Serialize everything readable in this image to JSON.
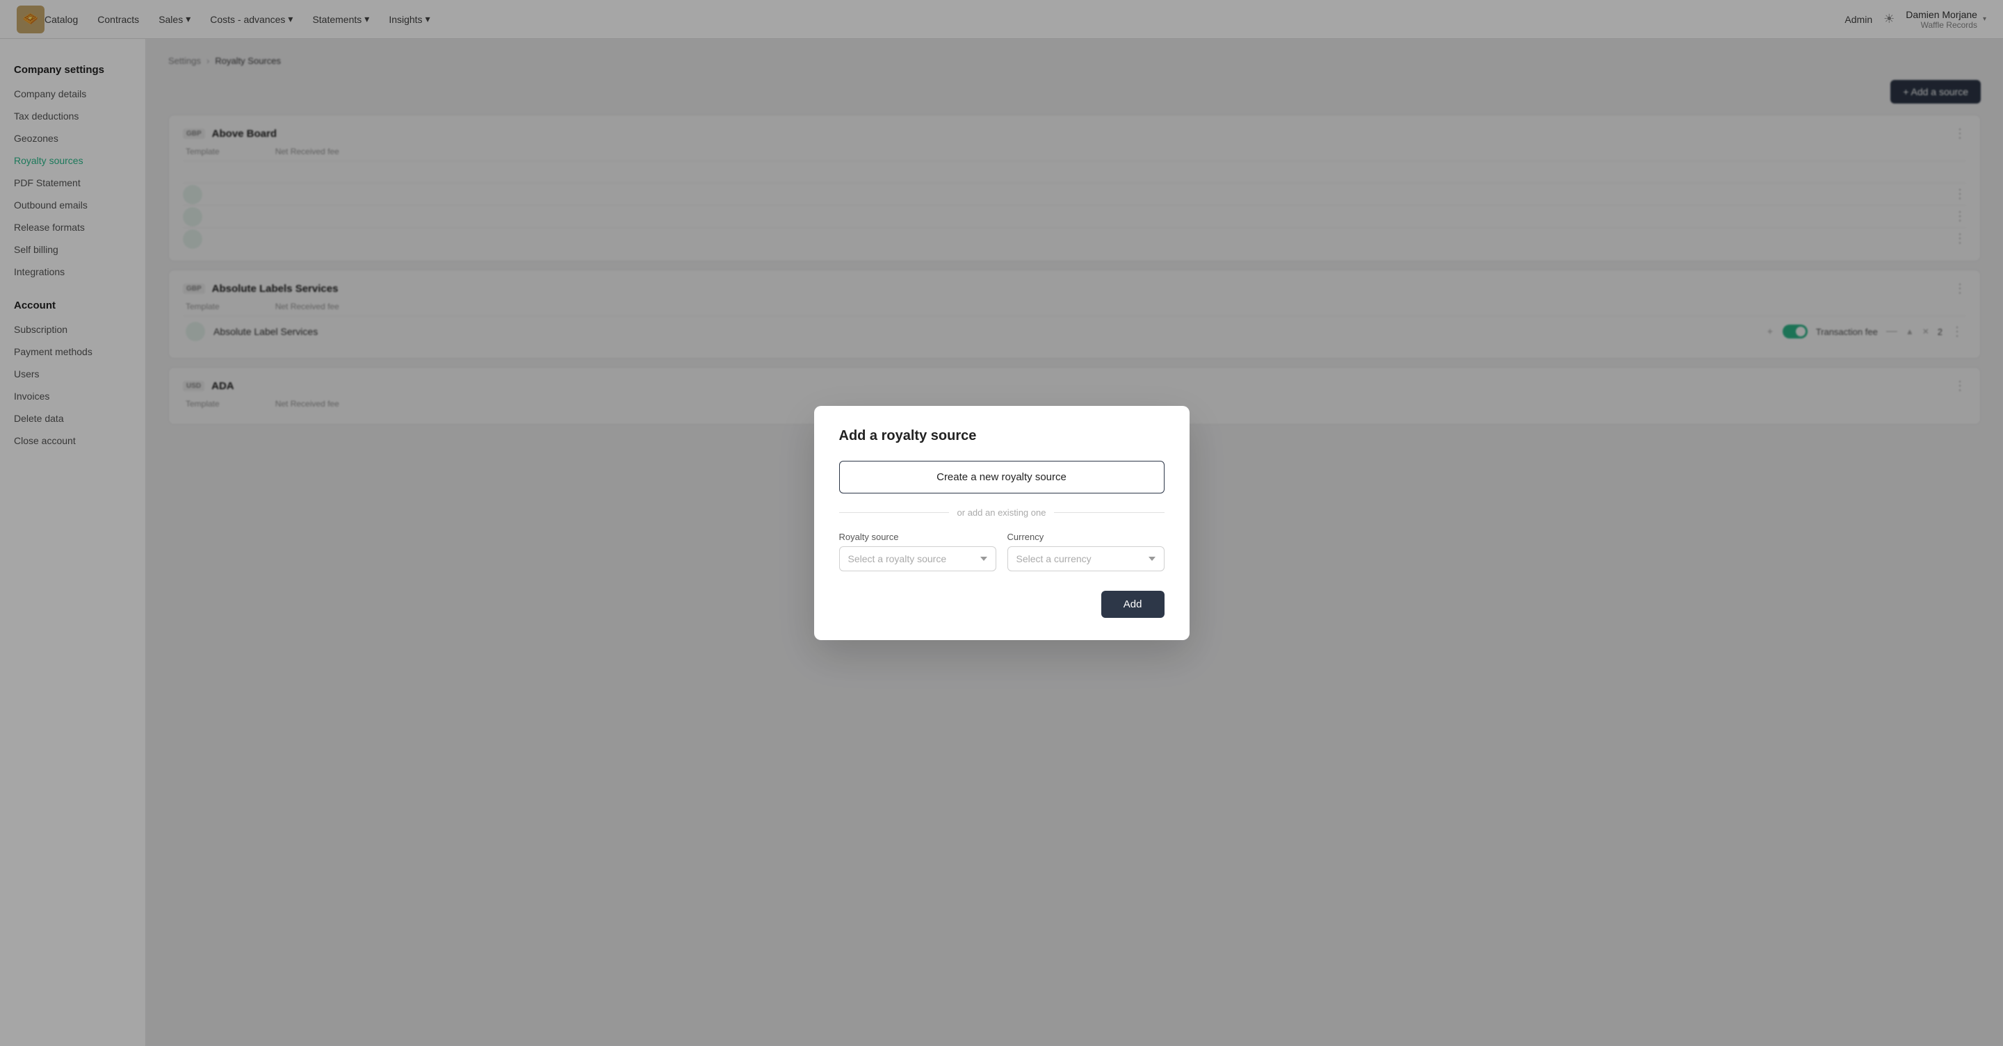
{
  "app": {
    "logo_emoji": "🧇",
    "nav_links": [
      {
        "label": "Catalog",
        "has_dropdown": false
      },
      {
        "label": "Contracts",
        "has_dropdown": false
      },
      {
        "label": "Sales",
        "has_dropdown": true
      },
      {
        "label": "Costs - advances",
        "has_dropdown": true
      },
      {
        "label": "Statements",
        "has_dropdown": true
      },
      {
        "label": "Insights",
        "has_dropdown": true
      }
    ],
    "admin_label": "Admin",
    "user": {
      "name": "Damien Morjane",
      "company": "Waffle Records"
    }
  },
  "sidebar": {
    "company_settings_title": "Company settings",
    "company_items": [
      {
        "label": "Company details",
        "active": false
      },
      {
        "label": "Tax deductions",
        "active": false
      },
      {
        "label": "Geozones",
        "active": false
      },
      {
        "label": "Royalty sources",
        "active": true
      },
      {
        "label": "PDF Statement",
        "active": false
      },
      {
        "label": "Outbound emails",
        "active": false
      },
      {
        "label": "Release formats",
        "active": false
      },
      {
        "label": "Self billing",
        "active": false
      },
      {
        "label": "Integrations",
        "active": false
      }
    ],
    "account_title": "Account",
    "account_items": [
      {
        "label": "Subscription",
        "active": false
      },
      {
        "label": "Payment methods",
        "active": false
      },
      {
        "label": "Users",
        "active": false
      },
      {
        "label": "Invoices",
        "active": false
      },
      {
        "label": "Delete data",
        "active": false
      },
      {
        "label": "Close account",
        "active": false
      }
    ]
  },
  "breadcrumb": {
    "settings": "Settings",
    "current": "Royalty Sources"
  },
  "add_source_btn": "+ Add a source",
  "source_cards": [
    {
      "badge": "GBP",
      "name": "Above Board",
      "template_label": "Template",
      "net_received_label": "Net Received fee"
    },
    {
      "badge": "GBP",
      "name": "Absolute Labels Services",
      "template_label": "Template",
      "net_received_label": "Net Received fee",
      "rows": [
        {
          "name": "Absolute Label Services",
          "toggle": true,
          "fee_label": "Transaction fee",
          "num": "2"
        }
      ]
    },
    {
      "badge": "USD",
      "name": "ADA",
      "template_label": "Template",
      "net_received_label": "Net Received fee"
    }
  ],
  "modal": {
    "title": "Add a royalty source",
    "create_btn_label": "Create a new royalty source",
    "divider_text": "or add an existing one",
    "royalty_source_label": "Royalty source",
    "royalty_source_placeholder": "Select a royalty source",
    "currency_label": "Currency",
    "currency_placeholder": "Select a currency",
    "add_btn_label": "Add"
  }
}
